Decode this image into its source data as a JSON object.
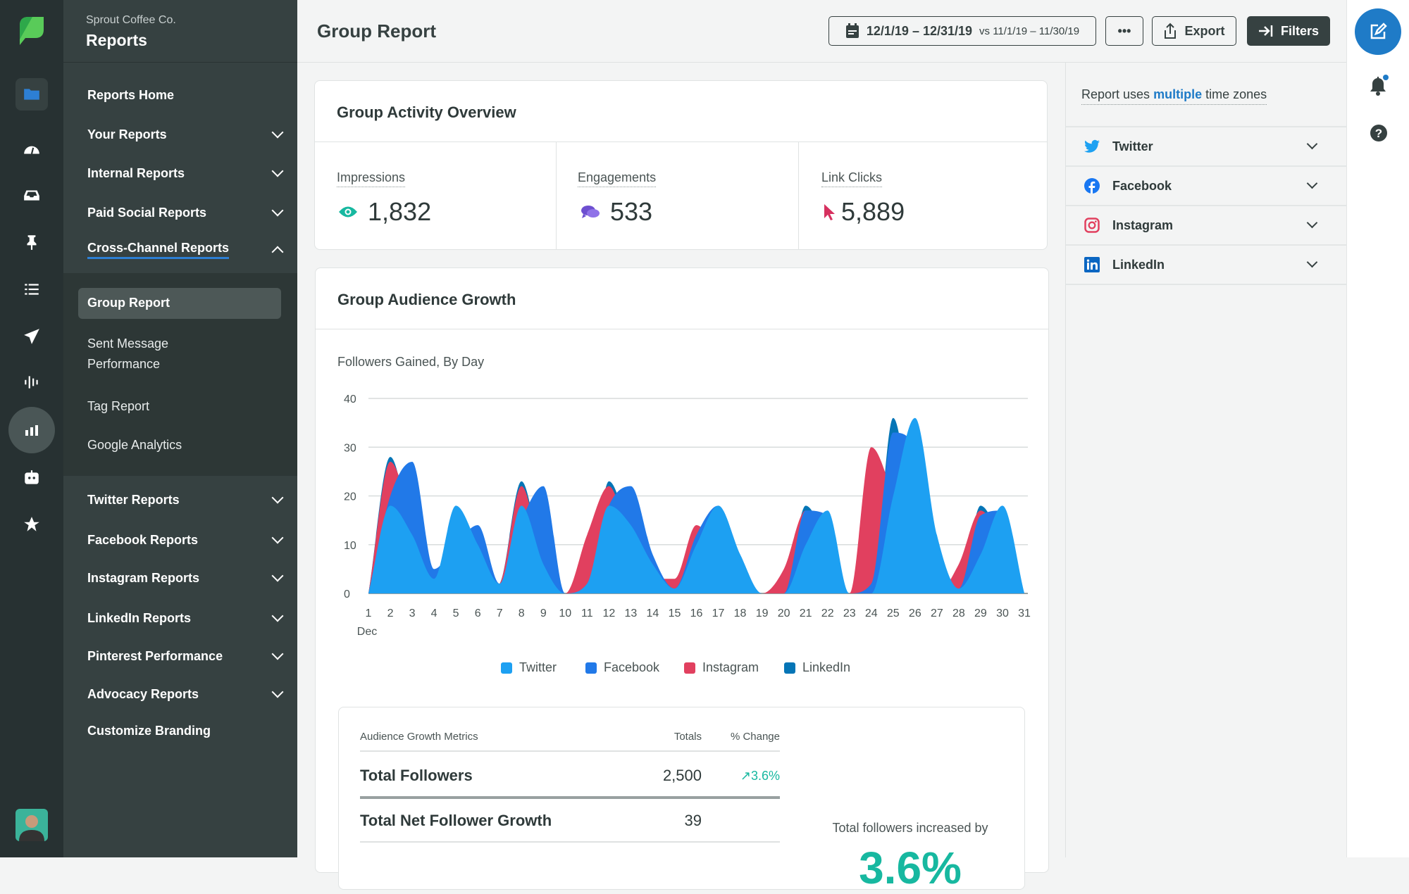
{
  "brand": {
    "org": "Sprout Coffee Co.",
    "section": "Reports"
  },
  "rail": [
    "folder-icon",
    "gauge-icon",
    "inbox-icon",
    "pin-icon",
    "list-icon",
    "paper-plane-icon",
    "audio-bars-icon",
    "bar-chart-icon",
    "bot-icon",
    "star-icon"
  ],
  "sidebar": {
    "top": [
      {
        "label": "Reports Home"
      },
      {
        "label": "Your Reports"
      },
      {
        "label": "Internal Reports"
      },
      {
        "label": "Paid Social Reports"
      },
      {
        "label": "Cross-Channel Reports"
      }
    ],
    "sub": [
      {
        "label": "Group Report"
      },
      {
        "label": "Sent Message"
      },
      {
        "label": "Performance"
      },
      {
        "label": "Tag Report"
      },
      {
        "label": "Google Analytics"
      }
    ],
    "bottom": [
      {
        "label": "Twitter Reports"
      },
      {
        "label": "Facebook Reports"
      },
      {
        "label": "Instagram Reports"
      },
      {
        "label": "LinkedIn Reports"
      },
      {
        "label": "Pinterest Performance"
      },
      {
        "label": "Advocacy Reports"
      },
      {
        "label": "Customize Branding"
      }
    ]
  },
  "header": {
    "title": "Group Report",
    "date_range": "12/1/19 – 12/31/19",
    "compare_range": "vs 11/1/19 – 11/30/19",
    "more": "•••",
    "export": "Export",
    "filters": "Filters"
  },
  "activity": {
    "title": "Group Activity Overview",
    "metrics": [
      {
        "label": "Impressions",
        "value": "1,832"
      },
      {
        "label": "Engagements",
        "value": "533"
      },
      {
        "label": "Link Clicks",
        "value": "5,889"
      }
    ]
  },
  "right_panel": {
    "tz_prefix": "Report uses",
    "tz_link": "multiple",
    "tz_suffix": "time zones",
    "networks": [
      {
        "label": "Twitter"
      },
      {
        "label": "Facebook"
      },
      {
        "label": "Instagram"
      },
      {
        "label": "LinkedIn"
      }
    ]
  },
  "growth": {
    "title": "Group Audience Growth",
    "subtitle": "Followers Gained, By Day",
    "table": {
      "headers": [
        "Audience Growth Metrics",
        "Totals",
        "% Change"
      ],
      "rows": [
        {
          "metric": "Total Followers",
          "total": "2,500",
          "change": "3.6%"
        },
        {
          "metric": "Total Net Follower Growth",
          "total": "39",
          "change": ""
        }
      ]
    },
    "summary_label": "Total followers increased by",
    "summary_value": "3.6%"
  },
  "colors": {
    "twitter": "#1da0f2",
    "facebook": "#2179e8",
    "instagram": "#e1405f",
    "linkedin": "#0575b6",
    "accent": "#1f7bc7",
    "teal": "#17b8a0"
  },
  "chart_data": {
    "type": "area",
    "title": "Followers Gained, By Day",
    "xlabel": "Dec",
    "ylabel": "",
    "ylim": [
      0,
      40
    ],
    "yticks": [
      0,
      10,
      20,
      30,
      40
    ],
    "grid": true,
    "legend": "bottom",
    "x": [
      1,
      2,
      3,
      4,
      5,
      6,
      7,
      8,
      9,
      10,
      11,
      12,
      13,
      14,
      15,
      16,
      17,
      18,
      19,
      20,
      21,
      22,
      23,
      24,
      25,
      26,
      27,
      28,
      29,
      30,
      31
    ],
    "series": [
      {
        "name": "LinkedIn",
        "values": [
          0,
          28,
          12,
          3,
          0,
          0,
          2,
          23,
          6,
          0,
          0,
          23,
          12,
          3,
          0,
          0,
          0,
          0,
          0,
          0,
          18,
          10,
          0,
          0,
          36,
          12,
          0,
          0,
          18,
          10,
          0
        ]
      },
      {
        "name": "Instagram",
        "values": [
          0,
          27,
          15,
          3,
          0,
          0,
          2,
          22,
          6,
          0,
          12,
          22,
          10,
          3,
          3,
          14,
          8,
          0,
          0,
          5,
          17,
          4,
          0,
          30,
          20,
          6,
          0,
          6,
          17,
          10,
          0
        ]
      },
      {
        "name": "Facebook",
        "values": [
          0,
          20,
          27,
          5,
          10,
          14,
          2,
          15,
          22,
          0,
          2,
          18,
          22,
          8,
          1,
          12,
          18,
          8,
          0,
          0,
          17,
          16,
          0,
          2,
          33,
          30,
          10,
          1,
          16,
          17,
          0
        ]
      },
      {
        "name": "Twitter",
        "values": [
          0,
          18,
          12,
          3,
          18,
          10,
          2,
          18,
          6,
          0,
          2,
          18,
          14,
          6,
          1,
          10,
          18,
          8,
          0,
          0,
          10,
          17,
          0,
          0,
          20,
          36,
          12,
          1,
          8,
          18,
          0
        ]
      }
    ]
  }
}
